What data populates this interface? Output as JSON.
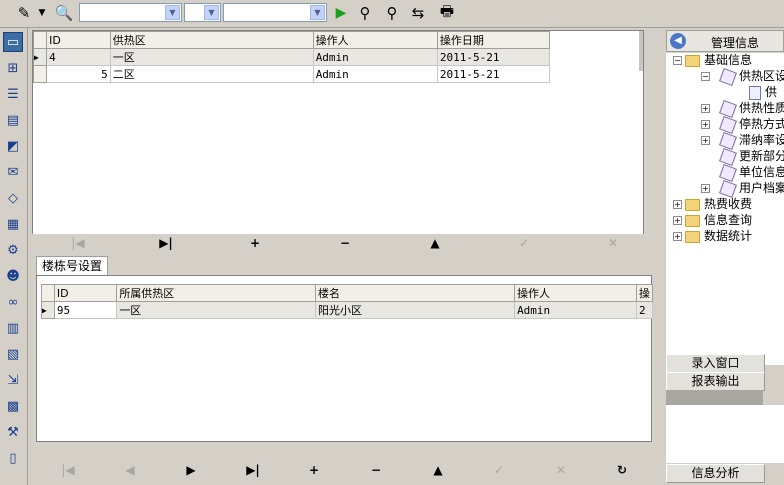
{
  "toolbar": {
    "icons": [
      "pencil-icon",
      "dropdown-arrow-icon",
      "find-icon",
      "run-icon",
      "search-icon",
      "search-next-icon",
      "replace-icon",
      "print-icon"
    ],
    "combo1": "",
    "combo2": "",
    "combo3": ""
  },
  "leftbar": {
    "icons": [
      "window-icon",
      "tree-icon",
      "list-icon",
      "document-icon",
      "chart-icon",
      "mail-icon",
      "tag-icon",
      "grid-icon",
      "settings-icon",
      "user-search-icon",
      "link-icon",
      "report-icon",
      "edit-doc-icon",
      "export-icon",
      "table-icon",
      "tools-icon",
      "trash-icon"
    ]
  },
  "top_grid": {
    "columns": [
      "ID",
      "供热区",
      "操作人",
      "操作日期"
    ],
    "rows": [
      {
        "id": "4",
        "area": "一区",
        "operator": "Admin",
        "date": "2011-5-21"
      },
      {
        "id": "5",
        "area": "二区",
        "operator": "Admin",
        "date": "2011-5-21"
      }
    ],
    "nav": [
      "|◀",
      "▶|",
      "+",
      "−",
      "▲",
      "✓",
      "✕"
    ]
  },
  "tab": {
    "label": "楼栋号设置"
  },
  "bottom_grid": {
    "columns": [
      "ID",
      "所属供热区",
      "楼名",
      "操作人",
      "操"
    ],
    "rows": [
      {
        "id": "95",
        "area": "一区",
        "building": "阳光小区",
        "operator": "Admin",
        "extra": "2"
      }
    ],
    "nav": [
      "|◀",
      "◀",
      "▶",
      "▶|",
      "+",
      "−",
      "▲",
      "✓",
      "✕",
      "↻"
    ]
  },
  "right_panel": {
    "title": "管理信息",
    "tree": [
      {
        "label": "基础信息"
      },
      {
        "label": "供热区设"
      },
      {
        "label": "供"
      },
      {
        "label": "供热性质"
      },
      {
        "label": "停热方式"
      },
      {
        "label": "滞纳率设"
      },
      {
        "label": "更新部分"
      },
      {
        "label": "单位信息"
      },
      {
        "label": "用户档案"
      },
      {
        "label": "热费收费"
      },
      {
        "label": "信息查询"
      },
      {
        "label": "数据统计"
      }
    ],
    "buttons": [
      "录入窗口",
      "报表输出"
    ],
    "bottom_button": "信息分析"
  }
}
